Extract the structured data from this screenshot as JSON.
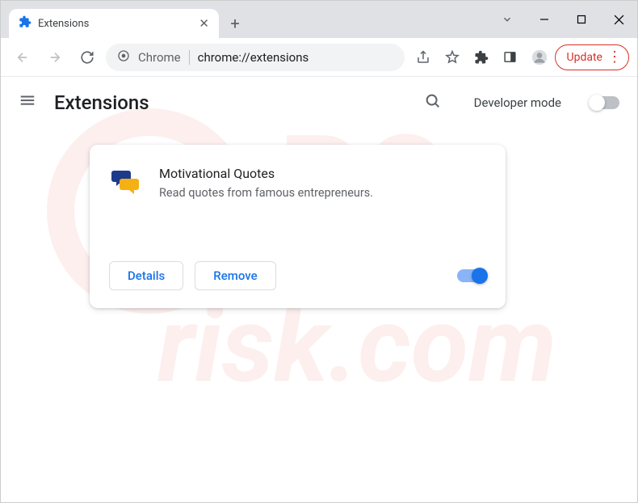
{
  "tab": {
    "title": "Extensions"
  },
  "omnibox": {
    "label": "Chrome",
    "url": "chrome://extensions"
  },
  "update": {
    "label": "Update"
  },
  "header": {
    "title": "Extensions",
    "devmode_label": "Developer mode"
  },
  "extension": {
    "name": "Motivational Quotes",
    "description": "Read quotes from famous entrepreneurs.",
    "details_label": "Details",
    "remove_label": "Remove",
    "enabled": true
  }
}
